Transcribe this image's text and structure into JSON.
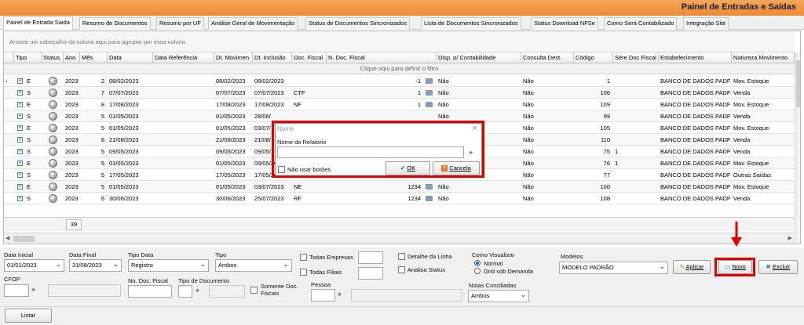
{
  "window": {
    "title": "Painel de Entradas e Saídas"
  },
  "tabs": [
    "Painel de Entrada Saida",
    "Resumo de Documentos",
    "Resumo por UF",
    "Análise Geral de Movimentação",
    "Status de Documentos Sincronizados",
    "Lista de Documentos Sincronizados",
    "Status Download NFSe",
    "Como Será Contabilizado",
    "Integração Site"
  ],
  "grid": {
    "group_hint": "Arraste um cabeçalho da coluna aqui para agrupar por essa coluna",
    "filter_hint": "Clique aqui para definir o filtro",
    "columns": [
      "Tipo",
      "Status",
      "Ano",
      "Mês",
      "Data",
      "Data Referência",
      "Dt. Movimen",
      "Dt. Inclusão",
      "Doc. Fiscal",
      "N. Doc. Fiscal",
      "Disp. p/ Contabilidade",
      "Consulta Dest.",
      "Código",
      "Sére Doc Fiscal",
      "Estabelecimento",
      "Natureza Movimento"
    ],
    "rows": [
      {
        "tipo": "E",
        "ano": "2023",
        "mes": "2",
        "data": "08/02/2023",
        "dtmov": "08/02/2023",
        "dtinc": "08/02/2023",
        "doc": "",
        "ndoc": "-1",
        "disp": "Não",
        "consulta": "Não",
        "codigo": "1",
        "serie": "",
        "estab": "BANCO DE DADOS PADF",
        "natureza": "Mov. Estoque"
      },
      {
        "tipo": "S",
        "ano": "2023",
        "mes": "7",
        "data": "07/07/2023",
        "dtmov": "07/07/2023",
        "dtinc": "07/07/2023",
        "doc": "CTF",
        "ndoc": "1",
        "disp": "Não",
        "consulta": "Não",
        "codigo": "106",
        "serie": "",
        "estab": "BANCO DE DADOS PADF",
        "natureza": "Venda"
      },
      {
        "tipo": "E",
        "ano": "2023",
        "mes": "8",
        "data": "17/08/2023",
        "dtmov": "17/08/2023",
        "dtinc": "17/08/2023",
        "doc": "NF",
        "ndoc": "1",
        "disp": "Não",
        "consulta": "Não",
        "codigo": "109",
        "serie": "",
        "estab": "BANCO DE DADOS PADF",
        "natureza": "Mov. Estoque"
      },
      {
        "tipo": "S",
        "ano": "2023",
        "mes": "5",
        "data": "01/05/2023",
        "dtmov": "01/05/2023",
        "dtinc": "28/06/",
        "doc": "",
        "ndoc": "",
        "disp": "Não",
        "consulta": "Não",
        "codigo": "99",
        "serie": "",
        "estab": "BANCO DE DADOS PADF",
        "natureza": "Venda"
      },
      {
        "tipo": "E",
        "ano": "2023",
        "mes": "5",
        "data": "01/05/2023",
        "dtmov": "01/05/2023",
        "dtinc": "03/07/",
        "doc": "",
        "ndoc": "",
        "disp": "Não",
        "consulta": "Não",
        "codigo": "105",
        "serie": "",
        "estab": "BANCO DE DADOS PADF",
        "natureza": "Mov. Estoque"
      },
      {
        "tipo": "S",
        "ano": "2023",
        "mes": "8",
        "data": "21/08/2023",
        "dtmov": "21/08/2023",
        "dtinc": "21/08/",
        "doc": "",
        "ndoc": "",
        "disp": "Não",
        "consulta": "Não",
        "codigo": "110",
        "serie": "",
        "estab": "BANCO DE DADOS PADF",
        "natureza": "Venda"
      },
      {
        "tipo": "S",
        "ano": "2023",
        "mes": "5",
        "data": "09/05/2023",
        "dtmov": "09/05/2023",
        "dtinc": "09/05/",
        "doc": "",
        "ndoc": "",
        "disp": "Não",
        "consulta": "Não",
        "codigo": "75",
        "serie": "1",
        "estab": "BANCO DE DADOS PADF",
        "natureza": "Venda"
      },
      {
        "tipo": "E",
        "ano": "2023",
        "mes": "5",
        "data": "01/05/2023",
        "dtmov": "01/05/2023",
        "dtinc": "09/05/2023",
        "doc": "",
        "ndoc": "",
        "disp": "Não",
        "consulta": "Não",
        "codigo": "76",
        "serie": "1",
        "estab": "BANCO DE DADOS PADF",
        "natureza": "Mov. Estoque"
      },
      {
        "tipo": "S",
        "ano": "2023",
        "mes": "5",
        "data": "17/05/2023",
        "dtmov": "17/05/2023",
        "dtinc": "17/05/2023",
        "doc": "NFS",
        "ndoc": "1234",
        "disp": "Não",
        "consulta": "Não",
        "codigo": "77",
        "serie": "",
        "estab": "BANCO DE DADOS PADF",
        "natureza": "Outras Saídas"
      },
      {
        "tipo": "E",
        "ano": "2023",
        "mes": "5",
        "data": "01/05/2023",
        "dtmov": "01/05/2023",
        "dtinc": "03/07/2023",
        "doc": "NE",
        "ndoc": "1234",
        "disp": "Não",
        "consulta": "Não",
        "codigo": "100",
        "serie": "",
        "estab": "BANCO DE DADOS PADF",
        "natureza": "Mov. Estoque"
      },
      {
        "tipo": "S",
        "ano": "2023",
        "mes": "6",
        "data": "30/06/2023",
        "dtmov": "30/06/2023",
        "dtinc": "25/07/2023",
        "doc": "RF",
        "ndoc": "1234",
        "disp": "Não",
        "consulta": "Não",
        "codigo": "108",
        "serie": "",
        "estab": "BANCO DE DADOS PADF",
        "natureza": "Venda"
      }
    ],
    "footer_count": "39"
  },
  "dialog": {
    "title": "Nome",
    "field_label": "Nome do Relatório",
    "field_value": "",
    "checkbox_label": "Não usar botões",
    "ok_label": "OK",
    "cancel_label": "Cancela"
  },
  "filters": {
    "data_inicial_label": "Data Inicial",
    "data_inicial": "01/01/2023",
    "data_final_label": "Data Final",
    "data_final": "31/08/2023",
    "tipo_data_label": "Tipo Data",
    "tipo_data": "Registro",
    "tipo_label": "Tipo",
    "tipo": "Ambos",
    "todas_empresas": "Todas Empresas",
    "todas_filiais": "Todas Filiais",
    "detalhe_linha": "Detalhe da Linha",
    "analisa_status": "Analisa Status",
    "como_visualizar_label": "Como Visualizar",
    "visualizar_options": [
      "Normal",
      "Grid sob Demanda"
    ],
    "visualizar_selected": "Normal",
    "modelos_label": "Modelos",
    "modelo": "MODELO PADRÃO",
    "aplicar": "Aplicar",
    "novo": "Novo",
    "excluir": "Excluir",
    "cfop_label": "CFOP",
    "no_doc_fiscal_label": "No. Doc. Fiscal",
    "tipo_documento_label": "Tipo de Documento",
    "somente_doc_fiscais": "Somente Doc. Fiscais",
    "pessoa_label": "Pessoa",
    "notas_conciliadas_label": "Notas Conciliadas",
    "notas_conciliadas": "Ambos"
  },
  "bottom": {
    "listar": "Listar"
  },
  "colors": {
    "titlebar": "#ef8a33",
    "highlight": "#e00000",
    "accent": "#2a5bd7"
  }
}
